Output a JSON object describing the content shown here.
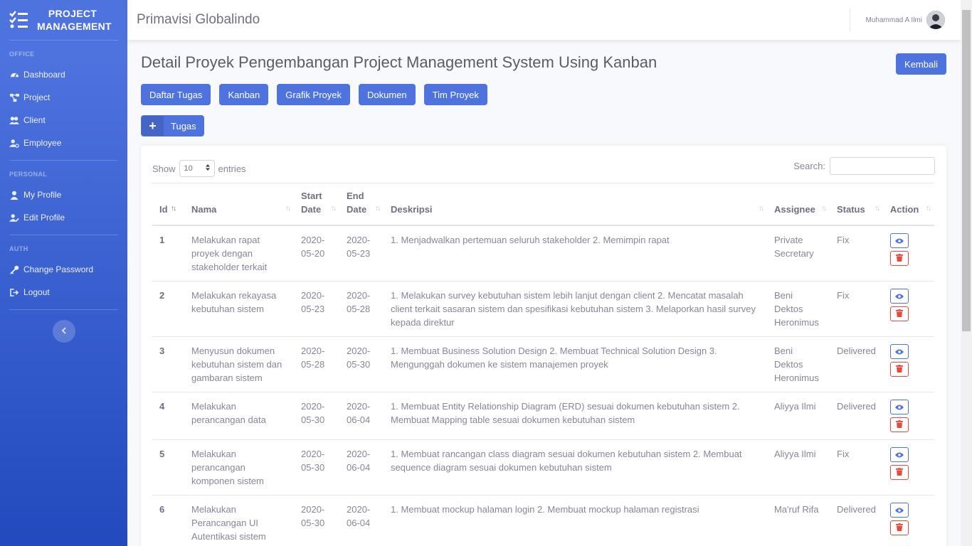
{
  "brand": {
    "line1": "PROJECT",
    "line2": "MANAGEMENT"
  },
  "sidebar": {
    "sections": [
      {
        "heading": "OFFICE",
        "items": [
          {
            "label": "Dashboard",
            "icon": "tachometer-icon"
          },
          {
            "label": "Project",
            "icon": "project-diagram-icon"
          },
          {
            "label": "Client",
            "icon": "users-icon"
          },
          {
            "label": "Employee",
            "icon": "user-cog-icon"
          }
        ]
      },
      {
        "heading": "PERSONAL",
        "items": [
          {
            "label": "My Profile",
            "icon": "user-icon"
          },
          {
            "label": "Edit Profile",
            "icon": "user-edit-icon"
          }
        ]
      },
      {
        "heading": "AUTH",
        "items": [
          {
            "label": "Change Password",
            "icon": "key-icon"
          },
          {
            "label": "Logout",
            "icon": "sign-out-icon"
          }
        ]
      }
    ]
  },
  "topbar": {
    "company": "Primavisi Globalindo",
    "username": "Muhammad A Ilmi"
  },
  "page": {
    "title": "Detail Proyek Pengembangan Project Management System Using Kanban",
    "back_label": "Kembali",
    "tabs": [
      "Daftar Tugas",
      "Kanban",
      "Grafik Proyek",
      "Dokumen",
      "Tim Proyek"
    ],
    "add_label": "Tugas"
  },
  "table_controls": {
    "show_label": "Show",
    "entries_value": "10",
    "entries_label": "entries",
    "search_label": "Search:",
    "search_value": ""
  },
  "table": {
    "columns": [
      "Id",
      "Nama",
      "Start Date",
      "End Date",
      "Deskripsi",
      "Assignee",
      "Status",
      "Action"
    ],
    "rows": [
      {
        "id": "1",
        "nama": "Melakukan rapat proyek dengan stakeholder terkait",
        "start": "2020-05-20",
        "end": "2020-05-23",
        "deskripsi": "1. Menjadwalkan pertemuan seluruh stakeholder 2. Memimpin rapat",
        "assignee": "Private Secretary",
        "status": "Fix"
      },
      {
        "id": "2",
        "nama": "Melakukan rekayasa kebutuhan sistem",
        "start": "2020-05-23",
        "end": "2020-05-28",
        "deskripsi": "1. Melakukan survey kebutuhan sistem lebih lanjut dengan client 2. Mencatat masalah client terkait sasaran sistem dan spesifikasi kebutuhan sistem 3. Melaporkan hasil survey kepada direktur",
        "assignee": "Beni Dektos Heronimus",
        "status": "Fix"
      },
      {
        "id": "3",
        "nama": "Menyusun dokumen kebutuhan sistem dan gambaran sistem",
        "start": "2020-05-28",
        "end": "2020-05-30",
        "deskripsi": "1. Membuat Business Solution Design 2. Membuat Technical Solution Design 3. Mengunggah dokumen ke sistem manajemen proyek",
        "assignee": "Beni Dektos Heronimus",
        "status": "Delivered"
      },
      {
        "id": "4",
        "nama": "Melakukan perancangan data",
        "start": "2020-05-30",
        "end": "2020-06-04",
        "deskripsi": "1. Membuat Entity Relationship Diagram (ERD) sesuai dokumen kebutuhan sistem 2. Membuat Mapping table sesuai dokumen kebutuhan sistem",
        "assignee": "Aliyya Ilmi",
        "status": "Delivered"
      },
      {
        "id": "5",
        "nama": "Melakukan perancangan komponen sistem",
        "start": "2020-05-30",
        "end": "2020-06-04",
        "deskripsi": "1. Membuat rancangan class diagram sesuai dokumen kebutuhan sistem 2. Membuat sequence diagram sesuai dokumen kebutuhan sistem",
        "assignee": "Aliyya Ilmi",
        "status": "Fix"
      },
      {
        "id": "6",
        "nama": "Melakukan Perancangan UI Autentikasi sistem",
        "start": "2020-05-30",
        "end": "2020-06-04",
        "deskripsi": "1. Membuat mockup halaman login 2. Membuat mockup halaman registrasi",
        "assignee": "Ma'ruf Rifa",
        "status": "Delivered"
      }
    ]
  }
}
